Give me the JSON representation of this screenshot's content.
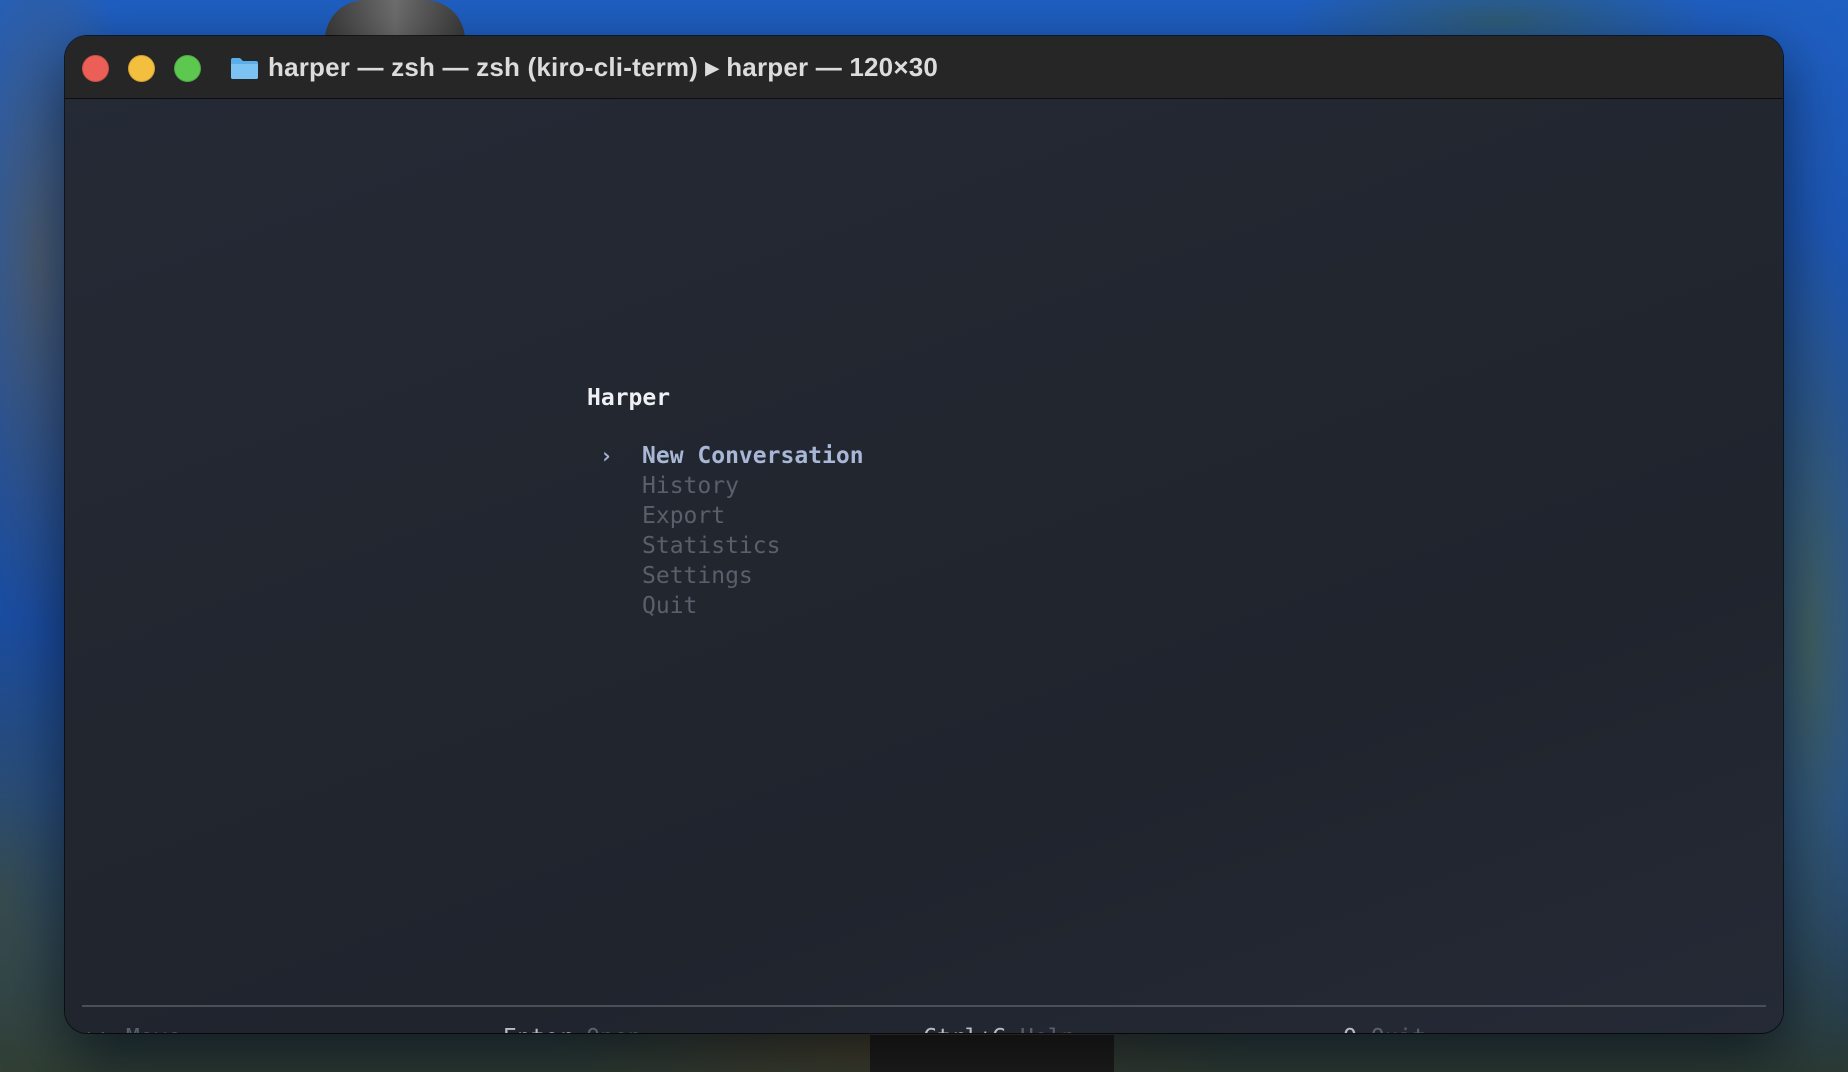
{
  "window": {
    "title": "harper — zsh — zsh (kiro-cli-term) ▸ harper — 120×30"
  },
  "app": {
    "title": "Harper"
  },
  "menu": {
    "selected_marker": "›",
    "items": [
      {
        "label": "New Conversation",
        "selected": true
      },
      {
        "label": "History",
        "selected": false
      },
      {
        "label": "Export",
        "selected": false
      },
      {
        "label": "Statistics",
        "selected": false
      },
      {
        "label": "Settings",
        "selected": false
      },
      {
        "label": "Quit",
        "selected": false
      }
    ]
  },
  "statusbar": {
    "move": {
      "icon": "up-down-arrows-icon",
      "key": "↑↓",
      "desc": "Move"
    },
    "open": {
      "key": "Enter",
      "desc": "Open"
    },
    "help": {
      "key": "Ctrl+G",
      "desc": "Help"
    },
    "quit": {
      "key": "Q",
      "desc": "Quit"
    }
  },
  "colors": {
    "close": "#ec5f57",
    "minimize": "#f4be3e",
    "maximize": "#5cc84f",
    "selected_item": "#a9b7d6",
    "dim_item": "#595f6b",
    "terminal_bg": "#22262f"
  }
}
